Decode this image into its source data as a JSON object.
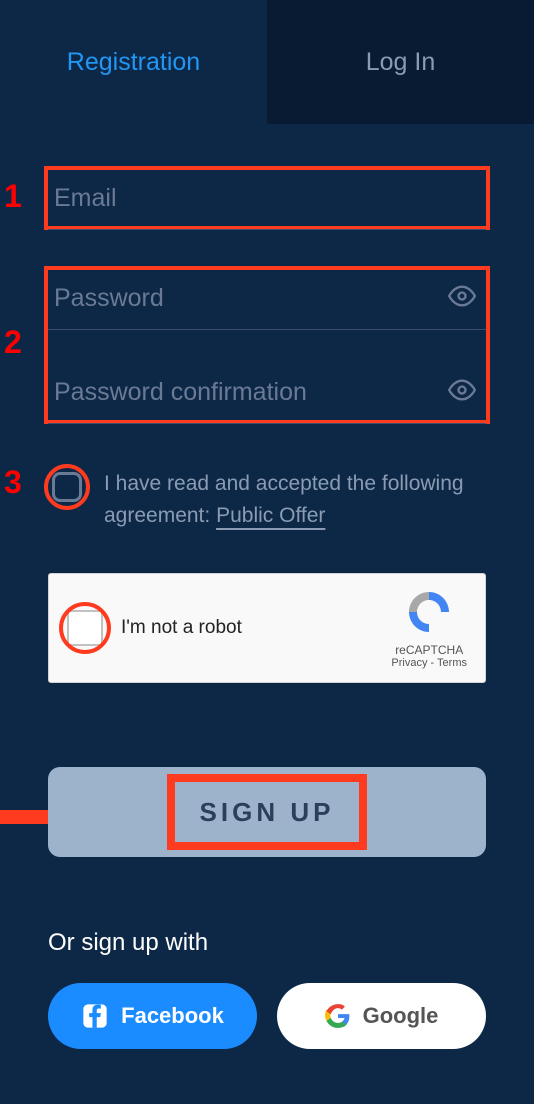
{
  "tabs": {
    "registration": "Registration",
    "login": "Log In"
  },
  "markers": {
    "one": "1",
    "two": "2",
    "three": "3"
  },
  "fields": {
    "email_placeholder": "Email",
    "password_placeholder": "Password",
    "confirm_placeholder": "Password confirmation"
  },
  "agreement": {
    "text_before": "I have read and accepted the following agreement: ",
    "link_text": "Public Offer"
  },
  "recaptcha": {
    "label": "I'm not a robot",
    "brand": "reCAPTCHA",
    "privacy": "Privacy",
    "terms": "Terms",
    "sep": " - "
  },
  "signup": "SIGN UP",
  "divider": "Or sign up with",
  "social": {
    "facebook": "Facebook",
    "google": "Google"
  }
}
